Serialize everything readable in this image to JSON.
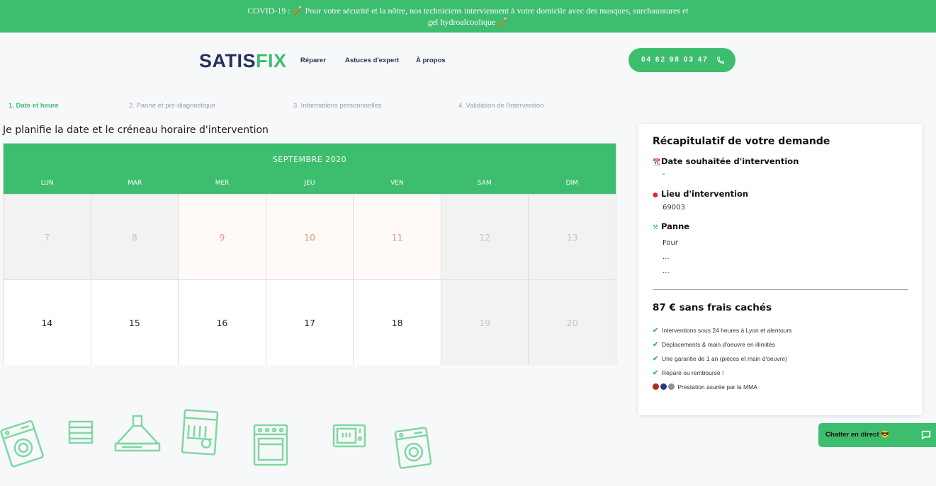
{
  "banner": {
    "line1": "COVID-19 : 🪥 Pour votre sécurité et la nôtre, nos techniciens interviennent à votre domicile avec des masques, surchaussures et",
    "line2": "gel hydroalcoolique 🪥"
  },
  "header": {
    "logo_part1": "SATIS",
    "logo_part2": "FIX",
    "nav": [
      "Réparer",
      "Astuces d'expert",
      "À propos"
    ],
    "phone": "04 82 98 03 47"
  },
  "steps": [
    {
      "label": "1. Date et heure",
      "active": true
    },
    {
      "label": "2. Panne et pré-diagnostique",
      "active": false
    },
    {
      "label": "3. Informations personnnelles",
      "active": false
    },
    {
      "label": "4. Validation de l'intervention",
      "active": false
    }
  ],
  "page_title": "Je planifie la date et le créneau horaire d'intervention",
  "calendar": {
    "month": "SEPTEMBRE 2020",
    "weekdays": [
      "LUN",
      "MAR",
      "MER",
      "JEU",
      "VEN",
      "SAM",
      "DIM"
    ],
    "weeks": [
      [
        {
          "day": "7",
          "state": "past"
        },
        {
          "day": "8",
          "state": "past"
        },
        {
          "day": "9",
          "state": "unavailable"
        },
        {
          "day": "10",
          "state": "unavailable"
        },
        {
          "day": "11",
          "state": "unavailable"
        },
        {
          "day": "12",
          "state": "past"
        },
        {
          "day": "13",
          "state": "past"
        }
      ],
      [
        {
          "day": "14",
          "state": "open"
        },
        {
          "day": "15",
          "state": "open"
        },
        {
          "day": "16",
          "state": "open"
        },
        {
          "day": "17",
          "state": "open"
        },
        {
          "day": "18",
          "state": "open"
        },
        {
          "day": "19",
          "state": "past"
        },
        {
          "day": "20",
          "state": "past"
        }
      ]
    ]
  },
  "recap": {
    "title": "Récapitulatif de votre demande",
    "date_label": "Date souhaitée d'intervention",
    "date_value": "-",
    "place_label": "Lieu d'intervention",
    "place_value": "69003",
    "panne_label": "Panne",
    "panne_value1": "Four",
    "panne_value2": "...",
    "panne_value3": "...",
    "price": "87 € sans frais cachés",
    "features": [
      "Interventions sous 24 heures à Lyon et alentours",
      "Déplacements & main d'oeuvre en illimités",
      "Une garantie de 1 an (pièces et main d'oeuvre)",
      "Réparé ou remboursé !"
    ],
    "insurance": "Prestation asurée par la MMA"
  },
  "chat": {
    "label": "Chatter en direct 😎"
  },
  "colors": {
    "brand_green": "#3cbe6e",
    "brand_navy": "#253158",
    "unavailable": "#e99478"
  },
  "icons": [
    "phone-icon",
    "calendar-icon",
    "pin-icon",
    "tools-icon",
    "check-icon",
    "chat-bubble-icon"
  ]
}
